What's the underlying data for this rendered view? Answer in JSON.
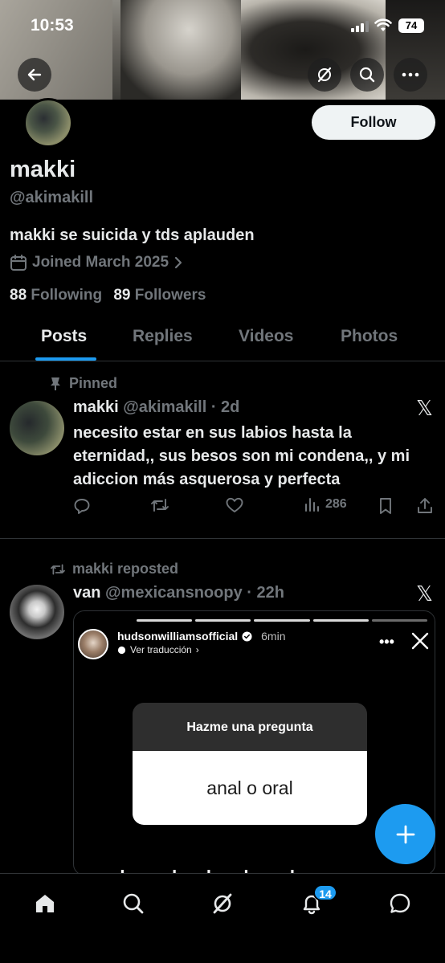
{
  "status_bar": {
    "time": "10:53",
    "battery": "74"
  },
  "profile": {
    "name": "makki",
    "handle": "@akimakill",
    "bio": "makki se suicida y tds aplauden",
    "joined": "Joined March 2025",
    "following_count": "88",
    "following_label": "Following",
    "followers_count": "89",
    "followers_label": "Followers",
    "follow_label": "Follow"
  },
  "tabs": [
    {
      "label": "Posts",
      "active": true
    },
    {
      "label": "Replies",
      "active": false
    },
    {
      "label": "Videos",
      "active": false
    },
    {
      "label": "Photos",
      "active": false
    }
  ],
  "posts": [
    {
      "context": "Pinned",
      "author": "makki",
      "meta": "@akimakill · 2d",
      "text": "necesito estar en sus labios hasta la eternidad,, sus besos son mi condena,, y mi adiccion más asquerosa y perfecta",
      "views": "286"
    },
    {
      "context": "makki reposted",
      "author": "van",
      "meta": "@mexicansnoopy · 22h",
      "media": {
        "story_user": "hudsonwilliamsofficial",
        "story_time": "6min",
        "story_sub": "Ver traducción",
        "question_title": "Hazme una pregunta",
        "question_answer": "anal o oral",
        "bottom_text": "depende, el oral muchas veces"
      }
    }
  ],
  "nav": {
    "notifications_badge": "14"
  },
  "colors": {
    "accent": "#1d9bf0",
    "background": "#000000",
    "muted": "#71767b",
    "text": "#e7e9ea"
  }
}
